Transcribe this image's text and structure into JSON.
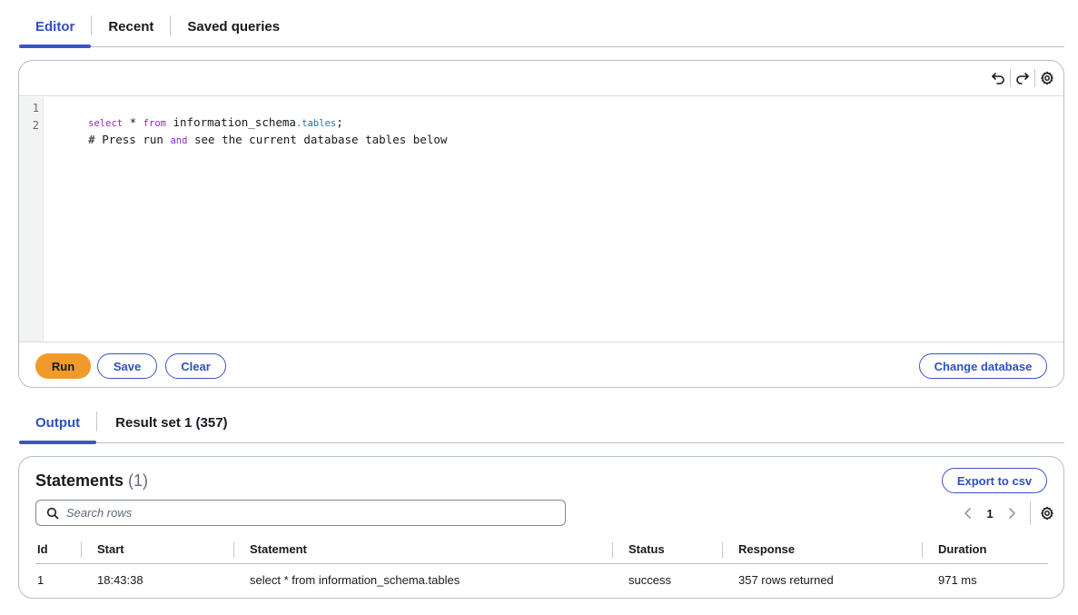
{
  "top_tabs": [
    {
      "label": "Editor",
      "active": true
    },
    {
      "label": "Recent",
      "active": false
    },
    {
      "label": "Saved queries",
      "active": false
    }
  ],
  "editor": {
    "toolbar_icons": [
      "undo-icon",
      "redo-icon",
      "settings-gear-icon"
    ],
    "lines": [
      {
        "number": "1",
        "tokens": [
          {
            "text": "select",
            "type": "keyword"
          },
          {
            "text": " * ",
            "type": "plain"
          },
          {
            "text": "from",
            "type": "keyword"
          },
          {
            "text": " information_schema",
            "type": "plain"
          },
          {
            "text": ".tables",
            "type": "property"
          },
          {
            "text": ";",
            "type": "plain"
          }
        ]
      },
      {
        "number": "2",
        "tokens": [
          {
            "text": "# Press run ",
            "type": "plain"
          },
          {
            "text": "and",
            "type": "keyword"
          },
          {
            "text": " see the current database tables below",
            "type": "plain"
          }
        ]
      }
    ],
    "buttons": {
      "run": "Run",
      "save": "Save",
      "clear": "Clear",
      "change_database": "Change database"
    }
  },
  "bottom_tabs": [
    {
      "label": "Output",
      "active": true
    },
    {
      "label": "Result set 1 (357)",
      "active": false
    }
  ],
  "statements": {
    "title": "Statements",
    "count": "(1)",
    "export_label": "Export to csv",
    "search_placeholder": "Search rows",
    "page": "1",
    "columns": [
      "Id",
      "Start",
      "Statement",
      "Status",
      "Response",
      "Duration"
    ],
    "rows": [
      [
        "1",
        "18:43:38",
        "select * from information_schema.tables",
        "success",
        "357 rows returned",
        "971 ms"
      ]
    ]
  },
  "colors": {
    "accent": "#3a55c4",
    "run_button": "#f09a2b",
    "keyword": "#9224d6",
    "property": "#1b7a9a"
  }
}
